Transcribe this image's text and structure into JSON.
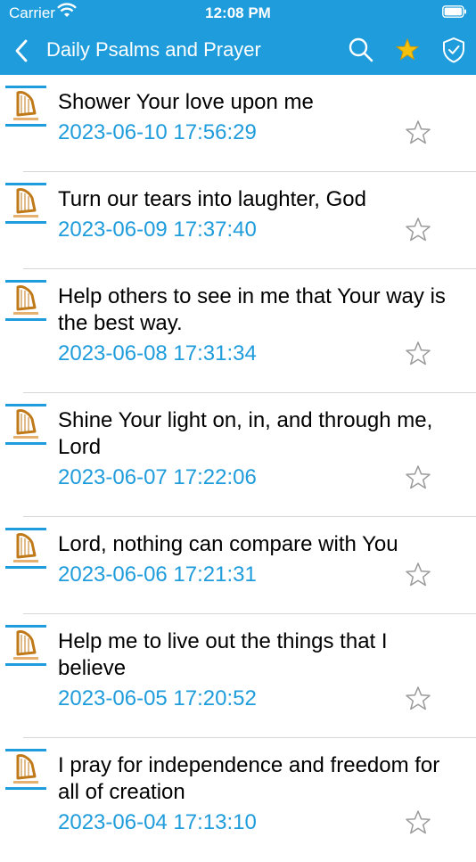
{
  "status_bar": {
    "carrier": "Carrier",
    "time": "12:08 PM"
  },
  "nav": {
    "title": "Daily Psalms and Prayer"
  },
  "items": [
    {
      "title": "Shower Your love upon me",
      "date": "2023-06-10 17:56:29"
    },
    {
      "title": "Turn our tears into laughter, God",
      "date": "2023-06-09 17:37:40"
    },
    {
      "title": "Help others to see in me that Your way is the best way.",
      "date": "2023-06-08 17:31:34"
    },
    {
      "title": "Shine Your light on, in, and through me, Lord",
      "date": "2023-06-07 17:22:06"
    },
    {
      "title": "Lord, nothing can compare with You",
      "date": "2023-06-06 17:21:31"
    },
    {
      "title": "Help me to live out the things that I believe",
      "date": "2023-06-05 17:20:52"
    },
    {
      "title": "I pray for independence and freedom for all of creation",
      "date": "2023-06-04 17:13:10"
    }
  ],
  "colors": {
    "accent": "#1f9cdb",
    "star_active": "#f4c20d",
    "star_outline": "#9a9a9a"
  },
  "icons": [
    "wifi-icon",
    "battery-icon",
    "back-chevron-icon",
    "search-icon",
    "favorites-star-icon",
    "shield-check-icon",
    "harp-thumbnail-icon",
    "star-outline-icon"
  ]
}
